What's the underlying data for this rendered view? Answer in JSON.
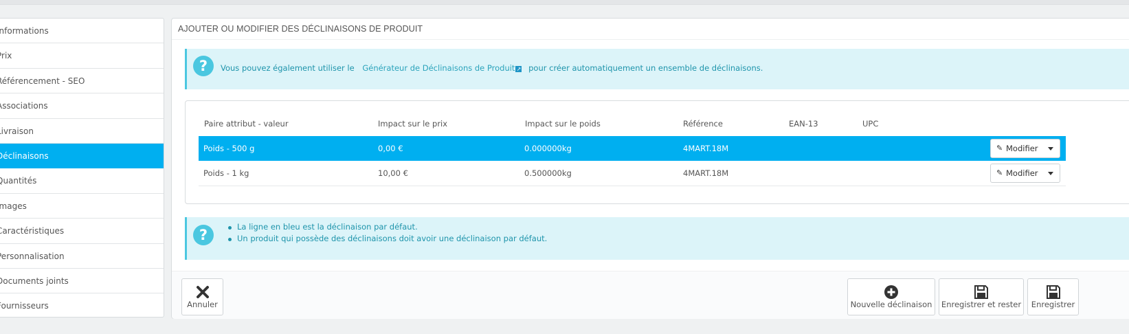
{
  "sidebar": {
    "items": [
      {
        "label": "Informations"
      },
      {
        "label": "Prix"
      },
      {
        "label": "Référencement - SEO"
      },
      {
        "label": "Associations"
      },
      {
        "label": "Livraison"
      },
      {
        "label": "Déclinaisons",
        "active": true
      },
      {
        "label": "Quantités"
      },
      {
        "label": "Images"
      },
      {
        "label": "Caractéristiques"
      },
      {
        "label": "Personnalisation"
      },
      {
        "label": "Documents joints"
      },
      {
        "label": "Fournisseurs"
      }
    ]
  },
  "panel": {
    "title": "Ajouter ou modifier des déclinaisons de produit",
    "info": {
      "prefix": "Vous pouvez également utiliser le",
      "link": "Générateur de Déclinaisons de Produit",
      "suffix": "pour créer automatiquement un ensemble de déclinaisons."
    },
    "table": {
      "headers": [
        "Paire attribut - valeur",
        "Impact sur le prix",
        "Impact sur le poids",
        "Référence",
        "EAN-13",
        "UPC"
      ],
      "rows": [
        {
          "attr": "Poids - 500 g",
          "price": "0,00 €",
          "weight": "0.000000kg",
          "ref": "4MART.18M",
          "ean": "",
          "upc": "",
          "default": true
        },
        {
          "attr": "Poids - 1 kg",
          "price": "10,00 €",
          "weight": "0.500000kg",
          "ref": "4MART.18M",
          "ean": "",
          "upc": "",
          "default": false
        }
      ],
      "action_label": "Modifier"
    },
    "notes": [
      "La ligne en bleu est la déclinaison par défaut.",
      "Un produit qui possède des déclinaisons doit avoir une déclinaison par défaut."
    ]
  },
  "footer": {
    "cancel": "Annuler",
    "new": "Nouvelle déclinaison",
    "save_stay": "Enregistrer et rester",
    "save": "Enregistrer"
  },
  "colors": {
    "accent": "#00aff0",
    "info_bg": "#dcf4f9",
    "info_border": "#4ac7e0"
  }
}
